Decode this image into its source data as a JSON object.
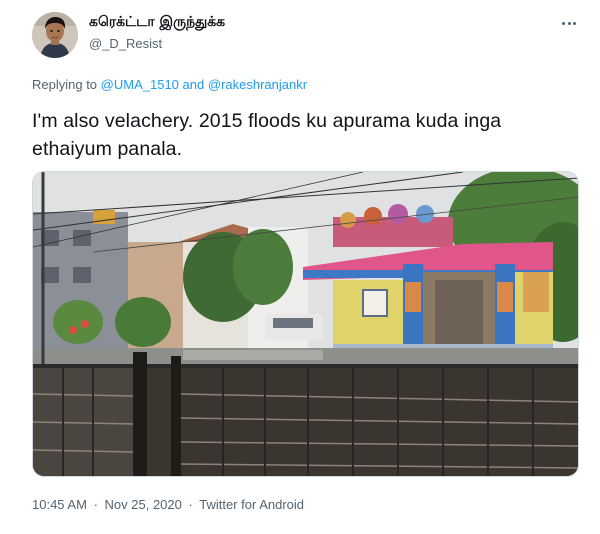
{
  "user": {
    "display_name": "கரெக்ட்டா இருந்துக்க",
    "handle": "@_D_Resist"
  },
  "reply": {
    "prefix": "Replying to",
    "mention_1": "@UMA_1510",
    "conjunction": "and",
    "mention_2": "@rakeshranjankr"
  },
  "tweet": {
    "text": "I'm also velachery. 2015 floods ku apurama kuda inga ethaiyum panala."
  },
  "meta": {
    "time": "10:45 AM",
    "date": "Nov 25, 2020",
    "source": "Twitter for Android",
    "separator": "·"
  },
  "colors": {
    "link": "#1d9bf0",
    "secondary_text": "#536471",
    "primary_text": "#0f1419"
  },
  "icons": {
    "more": "more-horizontal-icon"
  }
}
